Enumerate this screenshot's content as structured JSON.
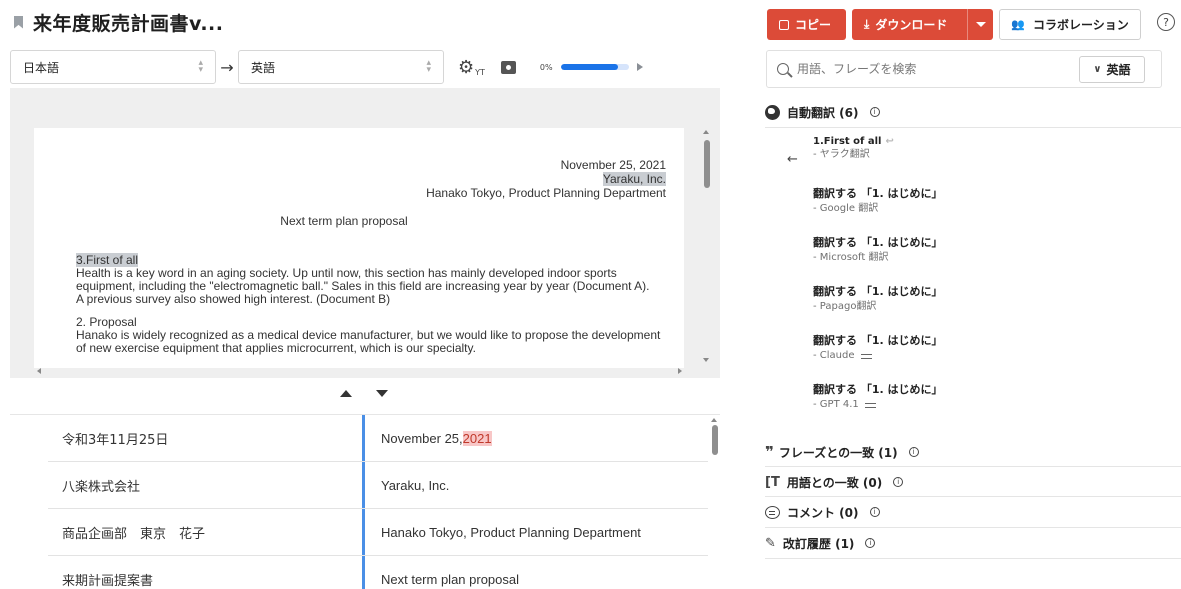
{
  "document": {
    "title": "来年度販売計画書v..."
  },
  "languages": {
    "source": "日本語",
    "target": "英語",
    "yt_label": "YT"
  },
  "progress": {
    "label": "0%",
    "value": 0.85
  },
  "preview": {
    "date": "November 25, 2021",
    "company": "Yaraku, Inc.",
    "department": "Hanako Tokyo, Product Planning Department",
    "heading": "Next term plan proposal",
    "section1_title": "3.First of all",
    "section1_body": "Health is a key word in an aging society. Up until now, this section has mainly developed indoor sports equipment, including the \"electromagnetic ball.\" Sales in this field are increasing year by year (Document A).",
    "section1_note": "A previous survey also showed high interest. (Document B)",
    "section2_title": "2. Proposal",
    "section2_body": "Hanako is widely recognized as a medical device manufacturer, but we would like to propose the development of new exercise equipment that applies microcurrent, which is our specialty."
  },
  "segments": [
    {
      "source": "令和3年11月25日",
      "target_prefix": "November 25, ",
      "target_highlight": "2021"
    },
    {
      "source": "八楽株式会社",
      "target": "Yaraku, Inc."
    },
    {
      "source": "商品企画部　東京　花子",
      "target": "Hanako Tokyo, Product Planning Department"
    },
    {
      "source": "来期計画提案書",
      "target": "Next term plan proposal"
    }
  ],
  "toolbar": {
    "copy_label": "コピー",
    "download_label": "ダウンロード",
    "collab_label": "コラボレーション",
    "help_label": "?"
  },
  "search": {
    "placeholder": "用語、フレーズを検索",
    "lang_label": "英語"
  },
  "auto_translation": {
    "header": "自動翻訳 (6)",
    "first_text": "1.First of all",
    "first_engine": "- ヤラク翻訳",
    "items": [
      {
        "text": "翻訳する 「1. はじめに」",
        "engine": "- Google 翻訳"
      },
      {
        "text": "翻訳する 「1. はじめに」",
        "engine": "- Microsoft 翻訳"
      },
      {
        "text": "翻訳する 「1. はじめに」",
        "engine": "- Papago翻訳"
      },
      {
        "text": "翻訳する 「1. はじめに」",
        "engine": "- Claude"
      },
      {
        "text": "翻訳する 「1. はじめに」",
        "engine": "- GPT 4.1"
      }
    ]
  },
  "sections": {
    "phrase_match": "フレーズとの一致 (1)",
    "term_match": "用語との一致 (0)",
    "comments": "コメント (0)",
    "history": "改訂履歴 (1)"
  },
  "icons": {
    "bookmark": "bookmark-icon",
    "gear": "gear-icon",
    "camera": "camera-icon",
    "globe": "globe-icon",
    "search": "search-icon",
    "copy": "copy-icon",
    "download": "download-icon",
    "people": "people-icon"
  },
  "colors": {
    "accent_red": "#dc4b38",
    "accent_blue": "#1a73e8",
    "highlight_pink": "#f8c7c7"
  }
}
